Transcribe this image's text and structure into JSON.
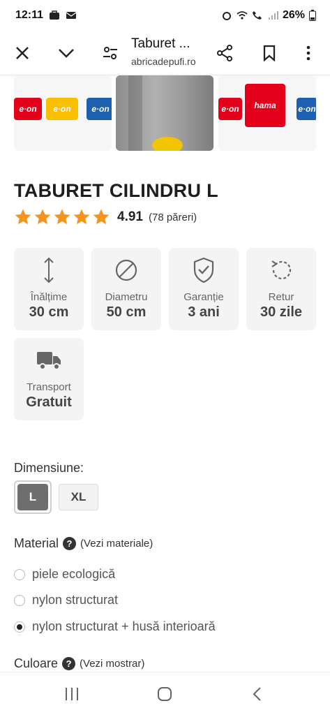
{
  "status_bar": {
    "time": "12:11",
    "battery": "26%"
  },
  "browser": {
    "page_title": "Taburet ...",
    "url": "abricadepufi.ro"
  },
  "product": {
    "title": "TABURET CILINDRU L",
    "rating_score": "4.91",
    "rating_count": "(78 păreri)",
    "stars": 5,
    "specs": [
      {
        "label": "Înălțime",
        "value": "30 cm",
        "icon": "height-arrows-icon"
      },
      {
        "label": "Diametru",
        "value": "50 cm",
        "icon": "diameter-icon"
      },
      {
        "label": "Garanție",
        "value": "3 ani",
        "icon": "shield-check-icon"
      },
      {
        "label": "Retur",
        "value": "30 zile",
        "icon": "return-arrow-icon"
      },
      {
        "label": "Transport",
        "value": "Gratuit",
        "icon": "truck-icon"
      }
    ],
    "thumb_texts": {
      "eon": "e·on",
      "hama": "hama"
    }
  },
  "size": {
    "label": "Dimensiune:",
    "options": [
      "L",
      "XL"
    ],
    "selected": "L"
  },
  "material": {
    "label": "Material",
    "link": "(Vezi materiale)",
    "options": [
      {
        "label": "piele ecologică",
        "checked": false
      },
      {
        "label": "nylon structurat",
        "checked": false
      },
      {
        "label": "nylon structurat + husă interioară",
        "checked": true
      }
    ]
  },
  "color": {
    "label": "Culoare",
    "link": "(Vezi mostrar)"
  },
  "colors": {
    "star": "#f7941d",
    "selected_size_bg": "#6e6e6e",
    "eon_red": "#e3001b",
    "eon_yellow": "#f9c000",
    "eon_blue": "#1f5fb0"
  }
}
